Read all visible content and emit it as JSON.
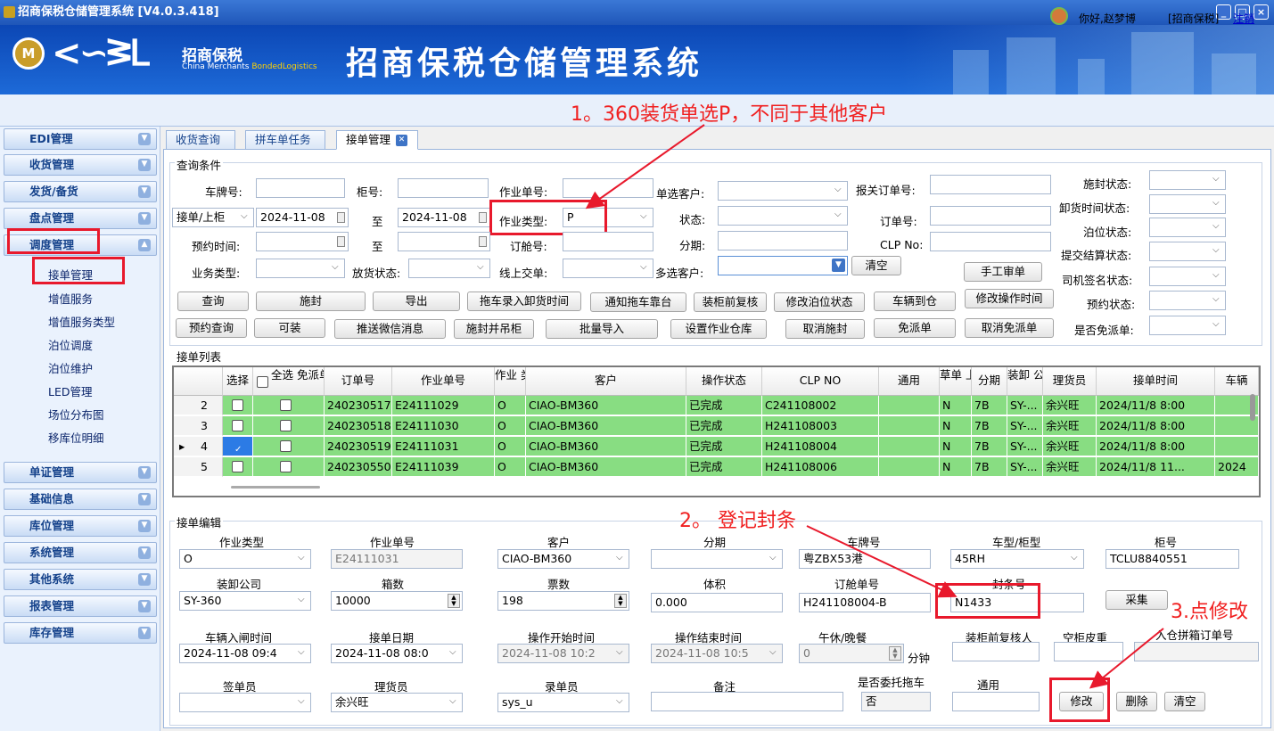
{
  "window": {
    "title": "招商保税仓储管理系统 [V4.0.3.418]"
  },
  "banner": {
    "logo_cn": "招商保税",
    "logo_en_1": "China Merchants",
    "logo_en_2": "BondedLogistics",
    "system_title": "招商保税仓储管理系统"
  },
  "user": {
    "greeting": "你好,赵梦博",
    "company": "[招商保税]",
    "logout": "注销"
  },
  "annotations": {
    "a1": "1。360装货单选P，不同于其他客户",
    "a2": "2。 登记封条",
    "a3": "3.点修改"
  },
  "sidebar": {
    "groups": [
      "EDI管理",
      "收货管理",
      "发货/备货",
      "盘点管理",
      "调度管理"
    ],
    "sub_items": [
      "接单管理",
      "增值服务",
      "增值服务类型",
      "泊位调度",
      "泊位维护",
      "LED管理",
      "场位分布图",
      "移库位明细"
    ],
    "groups_bottom": [
      "单证管理",
      "基础信息",
      "库位管理",
      "系统管理",
      "其他系统",
      "报表管理",
      "库存管理"
    ]
  },
  "tabs": [
    "收货查询",
    "拼车单任务",
    "接单管理"
  ],
  "query": {
    "legend": "查询条件",
    "labels": {
      "plate": "车牌号:",
      "cabinet": "柜号:",
      "job_no": "作业单号:",
      "single_customer": "单选客户:",
      "customs_no": "报关订单号:",
      "seal_status": "施封状态:",
      "unload_time_status": "卸货时间状态:",
      "to1": "至",
      "job_type": "作业类型:",
      "status": "状态:",
      "order_no": "订单号:",
      "berth_status": "泊位状态:",
      "appt_time": "预约时间:",
      "to2": "至",
      "booking_no": "订舱号:",
      "period": "分期:",
      "clp_no": "CLP No:",
      "settle_status": "提交结算状态:",
      "biz_type": "业务类型:",
      "release_status": "放货状态:",
      "online_handover": "线上交单:",
      "multi_customer": "多选客户:",
      "driver_sign": "司机签名状态:",
      "appt_status": "预约状态:",
      "free_dispatch": "是否免派单:"
    },
    "values": {
      "date_type": "接单/上柜",
      "date_from": "2024-11-08",
      "date_to": "2024-11-08",
      "job_type": "P"
    },
    "buttons_row1": [
      "清空",
      "手工审单"
    ],
    "buttons_row2": [
      "查询",
      "施封",
      "导出",
      "拖车录入卸货时间",
      "通知拖车靠台",
      "装柜前复核",
      "修改泊位状态",
      "车辆到仓",
      "修改操作时间"
    ],
    "buttons_row3": [
      "预约查询",
      "可装",
      "推送微信消息",
      "施封并吊柜",
      "批量导入",
      "设置作业仓库",
      "取消施封",
      "免派单",
      "取消免派单"
    ]
  },
  "list": {
    "legend": "接单列表",
    "headers": [
      "选择",
      "全选 免派单",
      "订单号",
      "作业单号",
      "作业 类型",
      "客户",
      "操作状态",
      "CLP NO",
      "通用",
      "草单 上传",
      "分期",
      "装卸 公司",
      "理货员",
      "接单时间",
      "车辆"
    ],
    "rows": [
      {
        "no": "2",
        "order": "240230517",
        "job": "E24111029",
        "type": "O",
        "customer": "CIAO-BM360",
        "status": "已完成",
        "clp": "C241108002",
        "general": "",
        "draft": "N",
        "period": "7B",
        "company": "SY-...",
        "tally": "余兴旺",
        "time": "2024/11/8 8:00",
        "vehicle": "",
        "checked": false
      },
      {
        "no": "3",
        "order": "240230518",
        "job": "E24111030",
        "type": "O",
        "customer": "CIAO-BM360",
        "status": "已完成",
        "clp": "H241108003",
        "general": "",
        "draft": "N",
        "period": "7B",
        "company": "SY-...",
        "tally": "余兴旺",
        "time": "2024/11/8 8:00",
        "vehicle": "",
        "checked": false
      },
      {
        "no": "4",
        "order": "240230519",
        "job": "E24111031",
        "type": "O",
        "customer": "CIAO-BM360",
        "status": "已完成",
        "clp": "H241108004",
        "general": "",
        "draft": "N",
        "period": "7B",
        "company": "SY-...",
        "tally": "余兴旺",
        "time": "2024/11/8 8:00",
        "vehicle": "",
        "checked": true
      },
      {
        "no": "5",
        "order": "240230550",
        "job": "E24111039",
        "type": "O",
        "customer": "CIAO-BM360",
        "status": "已完成",
        "clp": "H241108006",
        "general": "",
        "draft": "N",
        "period": "7B",
        "company": "SY-...",
        "tally": "余兴旺",
        "time": "2024/11/8 11...",
        "vehicle": "2024",
        "checked": false
      }
    ]
  },
  "edit": {
    "legend": "接单编辑",
    "row1": {
      "labels": [
        "作业类型",
        "作业单号",
        "客户",
        "分期",
        "车牌号",
        "车型/柜型",
        "柜号"
      ],
      "values": [
        "O",
        "E24111031",
        "CIAO-BM360",
        "",
        "粤ZBX53港",
        "45RH",
        "TCLU8840551"
      ]
    },
    "row2": {
      "labels": [
        "装卸公司",
        "箱数",
        "票数",
        "体积",
        "订舱单号",
        "封条号"
      ],
      "values": [
        "SY-360",
        "10000",
        "198",
        "0.000",
        "H241108004-B",
        "N1433"
      ],
      "collect": "采集"
    },
    "row3": {
      "labels": [
        "车辆入闸时间",
        "接单日期",
        "操作开始时间",
        "操作结束时间",
        "午休/晚餐",
        "装柜前复核人",
        "空柜皮重",
        "入仓拼箱订单号"
      ],
      "values": [
        "2024-11-08 09:4",
        "2024-11-08 08:0",
        "2024-11-08 10:2",
        "2024-11-08 10:5",
        "0"
      ],
      "unit": "分钟"
    },
    "row4": {
      "labels": [
        "签单员",
        "理货员",
        "录单员",
        "备注",
        "是否委托拖车",
        "通用"
      ],
      "values": [
        "",
        "余兴旺",
        "sys_u",
        "",
        "否",
        ""
      ]
    },
    "buttons": [
      "修改",
      "删除",
      "清空"
    ]
  }
}
